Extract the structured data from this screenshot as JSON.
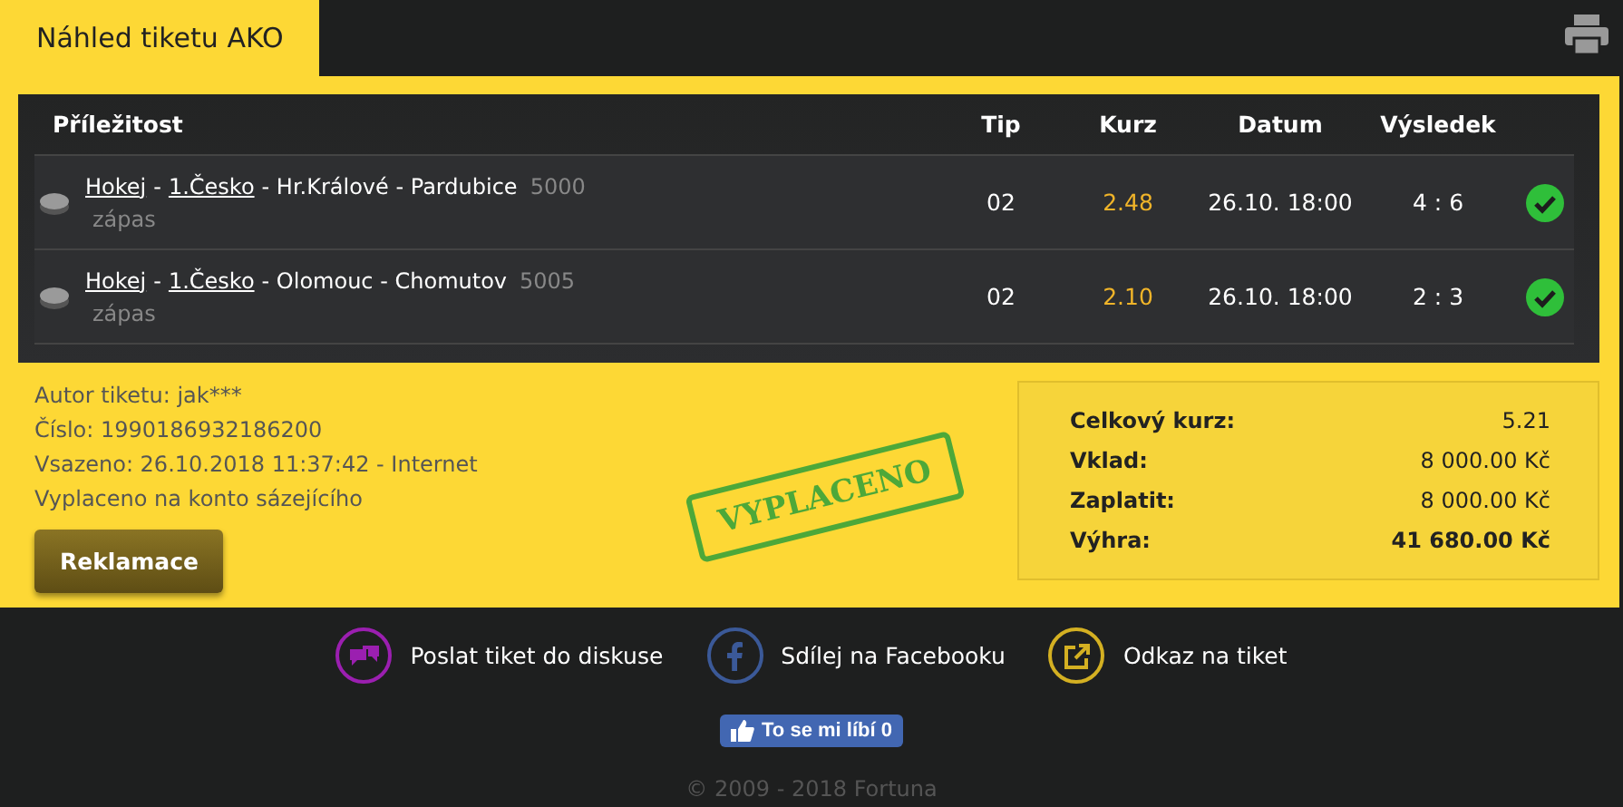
{
  "header": {
    "title": "Náhled tiketu AKO"
  },
  "table": {
    "columns": [
      "Příležitost",
      "Tip",
      "Kurz",
      "Datum",
      "Výsledek"
    ],
    "rows": [
      {
        "parts": [
          {
            "text": "Hokej",
            "link": true
          },
          {
            "text": "-",
            "link": false
          },
          {
            "text": "1.Česko",
            "link": true
          },
          {
            "text": "- Hr.Králové - Pardubice",
            "link": false
          }
        ],
        "code": "5000",
        "type": "zápas",
        "tip": "02",
        "odds": "2.48",
        "date": "26.10. 18:00",
        "result": "4 : 6",
        "won": true
      },
      {
        "parts": [
          {
            "text": "Hokej",
            "link": true
          },
          {
            "text": "-",
            "link": false
          },
          {
            "text": "1.Česko",
            "link": true
          },
          {
            "text": "- Olomouc - Chomutov",
            "link": false
          }
        ],
        "code": "5005",
        "type": "zápas",
        "tip": "02",
        "odds": "2.10",
        "date": "26.10. 18:00",
        "result": "2 : 3",
        "won": true
      }
    ]
  },
  "info": [
    "Autor tiketu: jak***",
    "Číslo: 1990186932186200",
    "Vsazeno: 26.10.2018 11:37:42 - Internet",
    "Vyplaceno na konto sázejícího"
  ],
  "claim_button": "Reklamace",
  "stamp": "VYPLACENO",
  "summary": [
    {
      "label": "Celkový kurz:",
      "value": "5.21",
      "strong": false
    },
    {
      "label": "Vklad:",
      "value": "8 000.00 Kč",
      "strong": false
    },
    {
      "label": "Zaplatit:",
      "value": "8 000.00 Kč",
      "strong": false
    },
    {
      "label": "Výhra:",
      "value": "41 680.00 Kč",
      "strong": true
    }
  ],
  "actions": [
    {
      "kind": "discuss",
      "label": "Poslat tiket do diskuse",
      "color": "#9b1fb0"
    },
    {
      "kind": "facebook",
      "label": "Sdílej na Facebooku",
      "color": "#3b5998"
    },
    {
      "kind": "link",
      "label": "Odkaz na tiket",
      "color": "#d4b022"
    }
  ],
  "like_button": "To se mi líbí 0",
  "copyright": "© 2009 - 2018 Fortuna"
}
